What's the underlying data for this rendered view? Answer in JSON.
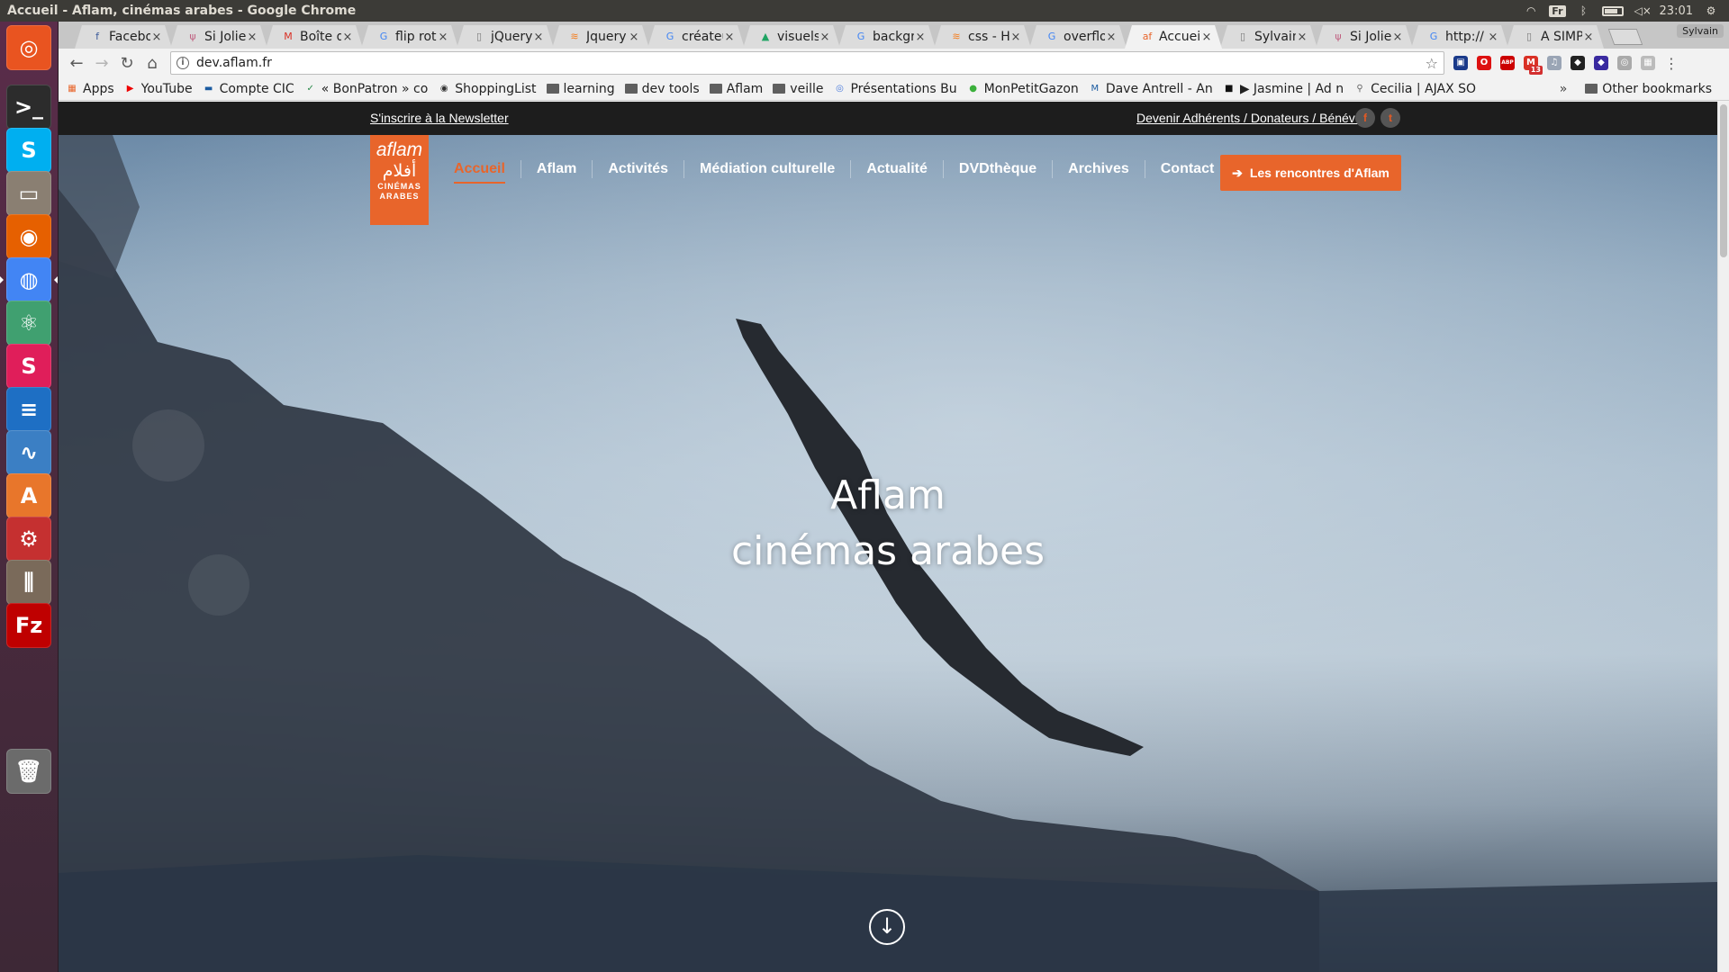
{
  "window": {
    "title": "Accueil - Aflam, cinémas arabes - Google Chrome"
  },
  "panel": {
    "keyboard_layout": "Fr",
    "clock": "23:01",
    "user": "Sylvain"
  },
  "launcher": {
    "items": [
      {
        "name": "ubuntu-dash",
        "glyph": "◎",
        "bg": "#e95420"
      },
      {
        "name": "terminal",
        "glyph": ">_",
        "bg": "#2c2c2c"
      },
      {
        "name": "skype",
        "glyph": "S",
        "bg": "#00aff0"
      },
      {
        "name": "files",
        "glyph": "▭",
        "bg": "#8a7f72"
      },
      {
        "name": "firefox",
        "glyph": "◉",
        "bg": "#e66000"
      },
      {
        "name": "chrome",
        "glyph": "◍",
        "bg": "#4285f4"
      },
      {
        "name": "atom",
        "glyph": "⚛",
        "bg": "#40a070"
      },
      {
        "name": "slack",
        "glyph": "S",
        "bg": "#e01e5a"
      },
      {
        "name": "writer",
        "glyph": "≡",
        "bg": "#1e6fc4"
      },
      {
        "name": "system-monitor",
        "glyph": "∿",
        "bg": "#3b7fc4"
      },
      {
        "name": "software-center",
        "glyph": "A",
        "bg": "#e8762b"
      },
      {
        "name": "system-settings",
        "glyph": "⚙",
        "bg": "#c53030"
      },
      {
        "name": "mixer",
        "glyph": "⫼",
        "bg": "#7a6a5a"
      },
      {
        "name": "filezilla",
        "glyph": "Fz",
        "bg": "#bf0000"
      },
      {
        "name": "trash",
        "glyph": "🗑",
        "bg": "#6b6b6b"
      }
    ]
  },
  "tabs": [
    {
      "label": "Facebook",
      "fav": "f",
      "fav_color": "#3b5998",
      "active": false
    },
    {
      "label": "Si Jolie",
      "fav": "ψ",
      "fav_color": "#c06080",
      "active": false
    },
    {
      "label": "Boîte de",
      "fav": "M",
      "fav_color": "#d93025",
      "active": false
    },
    {
      "label": "flip rota",
      "fav": "G",
      "fav_color": "#4285f4",
      "active": false
    },
    {
      "label": "jQuery",
      "fav": "▯",
      "fav_color": "#777",
      "active": false
    },
    {
      "label": "Jquery",
      "fav": "≋",
      "fav_color": "#f48024",
      "active": false
    },
    {
      "label": "créateur",
      "fav": "G",
      "fav_color": "#4285f4",
      "active": false
    },
    {
      "label": "visuels",
      "fav": "▲",
      "fav_color": "#1fa463",
      "active": false
    },
    {
      "label": "backgr",
      "fav": "G",
      "fav_color": "#4285f4",
      "active": false
    },
    {
      "label": "css - Ho",
      "fav": "≋",
      "fav_color": "#f48024",
      "active": false
    },
    {
      "label": "overflo",
      "fav": "G",
      "fav_color": "#4285f4",
      "active": false
    },
    {
      "label": "Accueil",
      "fav": "af",
      "fav_color": "#e8652b",
      "active": true
    },
    {
      "label": "Sylvain",
      "fav": "▯",
      "fav_color": "#777",
      "active": false
    },
    {
      "label": "Si Jolie",
      "fav": "ψ",
      "fav_color": "#c06080",
      "active": false
    },
    {
      "label": "http://",
      "fav": "G",
      "fav_color": "#4285f4",
      "active": false
    },
    {
      "label": "A SIMP",
      "fav": "▯",
      "fav_color": "#777",
      "active": false
    }
  ],
  "toolbar": {
    "back": "←",
    "forward": "→",
    "reload": "↻",
    "home": "⌂",
    "url": "dev.aflam.fr",
    "info": "i",
    "star": "☆",
    "menu": "⋮",
    "extensions": [
      {
        "name": "ext-1",
        "glyph": "▣",
        "bg": "#1a3a8a",
        "badge": ""
      },
      {
        "name": "opera-ext",
        "glyph": "O",
        "bg": "#d11",
        "badge": ""
      },
      {
        "name": "adblock-ext",
        "glyph": "ABP",
        "bg": "#c00",
        "badge": ""
      },
      {
        "name": "gmail-ext",
        "glyph": "M",
        "bg": "#d93025",
        "badge": "13"
      },
      {
        "name": "music-ext",
        "glyph": "♫",
        "bg": "#9aa5b5",
        "badge": ""
      },
      {
        "name": "ext-6",
        "glyph": "◆",
        "bg": "#222",
        "badge": ""
      },
      {
        "name": "ext-7",
        "glyph": "◆",
        "bg": "#3a2aa0",
        "badge": ""
      },
      {
        "name": "ext-8",
        "glyph": "◎",
        "bg": "#aaa",
        "badge": ""
      },
      {
        "name": "ext-9",
        "glyph": "▦",
        "bg": "#bbb",
        "badge": ""
      }
    ]
  },
  "bookmarks": {
    "items": [
      {
        "label": "Apps",
        "icon": "▦",
        "color": "#e8652b",
        "folder": false
      },
      {
        "label": "YouTube",
        "icon": "▶",
        "color": "#e00",
        "folder": false
      },
      {
        "label": "Compte CIC",
        "icon": "▬",
        "color": "#1a5aa0",
        "folder": false
      },
      {
        "label": "« BonPatron » co",
        "icon": "✓",
        "color": "#2a8a4a",
        "folder": false
      },
      {
        "label": "ShoppingList",
        "icon": "◉",
        "color": "#333",
        "folder": false
      },
      {
        "label": "learning",
        "icon": "",
        "color": "#5f5f5f",
        "folder": true
      },
      {
        "label": "dev tools",
        "icon": "",
        "color": "#5f5f5f",
        "folder": true
      },
      {
        "label": "Aflam",
        "icon": "",
        "color": "#5f5f5f",
        "folder": true
      },
      {
        "label": "veille",
        "icon": "",
        "color": "#5f5f5f",
        "folder": true
      },
      {
        "label": "Présentations Bu",
        "icon": "◎",
        "color": "#4a7adb",
        "folder": false
      },
      {
        "label": "MonPetitGazon",
        "icon": "●",
        "color": "#3bb03b",
        "folder": false
      },
      {
        "label": "Dave Antrell - An",
        "icon": "M",
        "color": "#1a5aa0",
        "folder": false
      },
      {
        "label": "▶ Jasmine | Ad n",
        "icon": "■",
        "color": "#111",
        "folder": false
      },
      {
        "label": "Cecilia | AJAX SO",
        "icon": "⚲",
        "color": "#666",
        "folder": false
      }
    ],
    "overflow": "»",
    "other": "Other bookmarks"
  },
  "site": {
    "newsletter": "S'inscrire à la Newsletter",
    "support": "Devenir Adhérents / Donateurs / Bénévole",
    "social": [
      {
        "name": "facebook",
        "glyph": "f"
      },
      {
        "name": "twitter",
        "glyph": "t"
      }
    ],
    "logo": {
      "main": "aflam",
      "arabic": "أفلام",
      "sub1": "CINÉMAS",
      "sub2": "ARABES"
    },
    "nav": [
      {
        "label": "Accueil",
        "current": true
      },
      {
        "label": "Aflam",
        "current": false
      },
      {
        "label": "Activités",
        "current": false
      },
      {
        "label": "Médiation culturelle",
        "current": false
      },
      {
        "label": "Actualité",
        "current": false
      },
      {
        "label": "DVDthèque",
        "current": false
      },
      {
        "label": "Archives",
        "current": false
      },
      {
        "label": "Contact",
        "current": false
      }
    ],
    "cta": "Les rencontres d'Aflam",
    "hero_line1": "Aflam",
    "hero_line2": "cinémas arabes",
    "scroll_down": "↓",
    "accent_color": "#e8652b"
  }
}
